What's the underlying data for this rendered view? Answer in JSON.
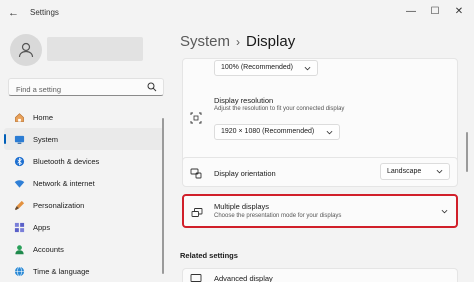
{
  "window": {
    "title": "Settings"
  },
  "search": {
    "placeholder": "Find a setting"
  },
  "sidebar": {
    "items": [
      {
        "label": "Home",
        "icon": "home-icon",
        "active": false
      },
      {
        "label": "System",
        "icon": "system-icon",
        "active": true
      },
      {
        "label": "Bluetooth & devices",
        "icon": "bluetooth-icon",
        "active": false
      },
      {
        "label": "Network & internet",
        "icon": "wifi-icon",
        "active": false
      },
      {
        "label": "Personalization",
        "icon": "brush-icon",
        "active": false
      },
      {
        "label": "Apps",
        "icon": "apps-icon",
        "active": false
      },
      {
        "label": "Accounts",
        "icon": "accounts-icon",
        "active": false
      },
      {
        "label": "Time & language",
        "icon": "globe-icon",
        "active": false
      }
    ]
  },
  "breadcrumb": {
    "root": "System",
    "separator": "›",
    "current": "Display"
  },
  "display": {
    "scale_value": "100% (Recommended)",
    "resolution_title": "Display resolution",
    "resolution_subtitle": "Adjust the resolution to fit your connected display",
    "resolution_value": "1920 × 1080 (Recommended)",
    "orientation_title": "Display orientation",
    "orientation_value": "Landscape",
    "multiple_title": "Multiple displays",
    "multiple_subtitle": "Choose the presentation mode for your displays"
  },
  "related": {
    "heading": "Related settings",
    "advanced_label": "Advanced display"
  },
  "colors": {
    "accent": "#005fb8",
    "highlight_border": "#d11f2a"
  }
}
